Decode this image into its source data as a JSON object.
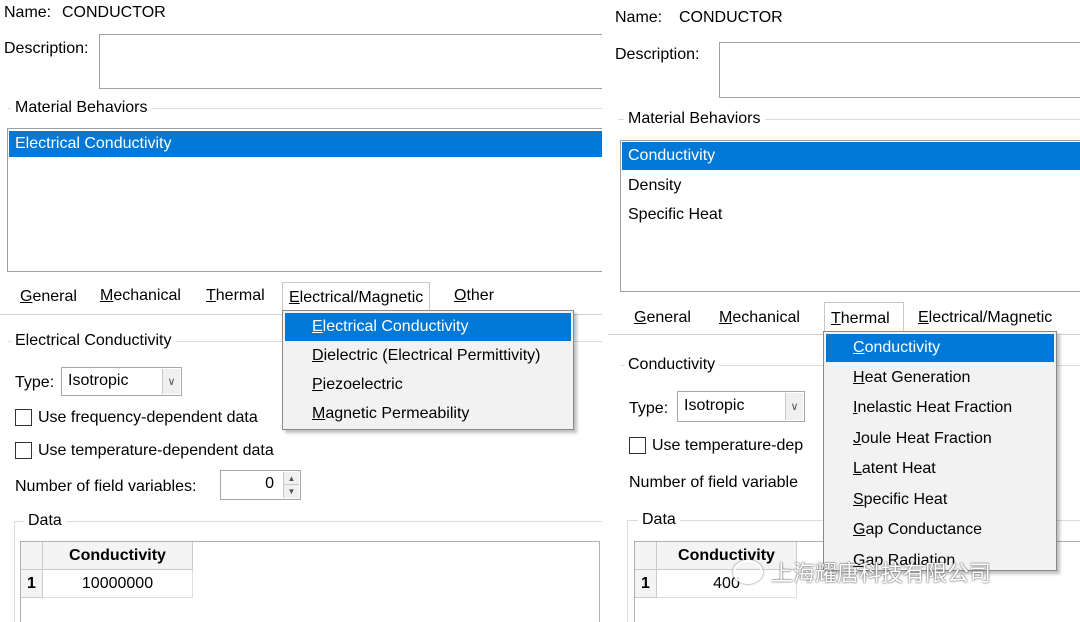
{
  "left": {
    "name_label": "Name:",
    "name_value": "CONDUCTOR",
    "description_label": "Description:",
    "behaviors_legend": "Material Behaviors",
    "behaviors": [
      "Electrical Conductivity"
    ],
    "tabs": [
      {
        "key": "G",
        "rest": "eneral"
      },
      {
        "key": "M",
        "rest": "echanical"
      },
      {
        "key": "T",
        "rest": "hermal"
      },
      {
        "key": "E",
        "rest": "lectrical/Magnetic"
      },
      {
        "key": "O",
        "rest": "ther"
      }
    ],
    "section_legend": "Electrical Conductivity",
    "type_label": "Type:",
    "type_value": "Isotropic",
    "check1": "Use frequency-dependent data",
    "check2": "Use temperature-dependent data",
    "field_vars_label": "Number of field variables:",
    "field_vars_value": "0",
    "data_legend": "Data",
    "table": {
      "header": "Conductivity",
      "row_no": "1",
      "value": "10000000"
    },
    "menu": [
      {
        "key": "E",
        "rest": "lectrical Conductivity"
      },
      {
        "key": "D",
        "rest": "ielectric (Electrical Permittivity)"
      },
      {
        "key": "P",
        "rest": "iezoelectric"
      },
      {
        "key": "M",
        "rest": "agnetic Permeability"
      }
    ]
  },
  "right": {
    "name_label": "Name:",
    "name_value": "CONDUCTOR",
    "description_label": "Description:",
    "behaviors_legend": "Material Behaviors",
    "behaviors": [
      "Conductivity",
      "Density",
      "Specific Heat"
    ],
    "tabs": [
      {
        "key": "G",
        "rest": "eneral"
      },
      {
        "key": "M",
        "rest": "echanical"
      },
      {
        "key": "T",
        "rest": "hermal"
      },
      {
        "key": "E",
        "rest": "lectrical/Magnetic"
      }
    ],
    "section_legend": "Conductivity",
    "type_label": "Type:",
    "type_value": "Isotropic",
    "check1": "Use temperature-dep",
    "field_vars_label": "Number of field variable",
    "data_legend": "Data",
    "table": {
      "header": "Conductivity",
      "row_no": "1",
      "value": "400"
    },
    "menu": [
      {
        "key": "C",
        "rest": "onductivity"
      },
      {
        "key": "H",
        "rest": "eat Generation"
      },
      {
        "key": "I",
        "rest": "nelastic Heat Fraction"
      },
      {
        "key": "J",
        "rest": "oule Heat Fraction"
      },
      {
        "key": "L",
        "rest": "atent Heat"
      },
      {
        "key": "S",
        "rest": "pecific Heat"
      },
      {
        "key": "G",
        "rest": "ap Conductance"
      },
      {
        "key": "G",
        "rest": "ap Radiation"
      }
    ]
  },
  "watermark": "上海耀唐科技有限公司",
  "colors": {
    "selection": "#0078d7",
    "menu_bg": "#f2f2f2"
  }
}
